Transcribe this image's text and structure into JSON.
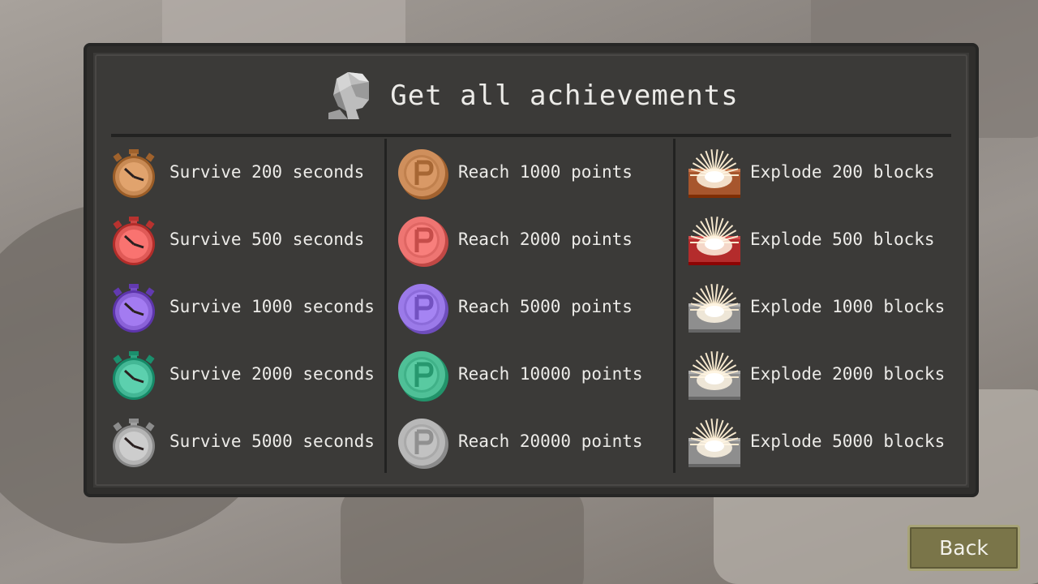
{
  "title": "Get all achievements",
  "back_label": "Back",
  "columns": [
    {
      "kind": "stopwatch-icon",
      "items": [
        {
          "label": "Survive 200 seconds",
          "color": "#c88a54"
        },
        {
          "label": "Survive 500 seconds",
          "color": "#e05a57"
        },
        {
          "label": "Survive 1000 seconds",
          "color": "#8a62d8"
        },
        {
          "label": "Survive 2000 seconds",
          "color": "#43b795"
        },
        {
          "label": "Survive 5000 seconds",
          "color": "#b4b4b4"
        }
      ]
    },
    {
      "kind": "points-coin-icon",
      "items": [
        {
          "label": "Reach 1000 points",
          "color": "#cf8f5c"
        },
        {
          "label": "Reach 2000 points",
          "color": "#ee7572"
        },
        {
          "label": "Reach 5000 points",
          "color": "#9b7ae9"
        },
        {
          "label": "Reach 10000 points",
          "color": "#4fc097"
        },
        {
          "label": "Reach 20000 points",
          "color": "#b8b8b8"
        }
      ]
    },
    {
      "kind": "explosion-block-icon",
      "items": [
        {
          "label": "Explode 200 blocks",
          "color": "#a7562d"
        },
        {
          "label": "Explode 500 blocks",
          "color": "#b42c2c"
        },
        {
          "label": "Explode 1000 blocks",
          "color": "#8e8e8e"
        },
        {
          "label": "Explode 2000 blocks",
          "color": "#8e8e8e"
        },
        {
          "label": "Explode 5000 blocks",
          "color": "#8e8e8e"
        }
      ]
    }
  ],
  "colors": {
    "panel": "#3b3a38",
    "text": "#ecebe8",
    "button": "#7a7549"
  }
}
